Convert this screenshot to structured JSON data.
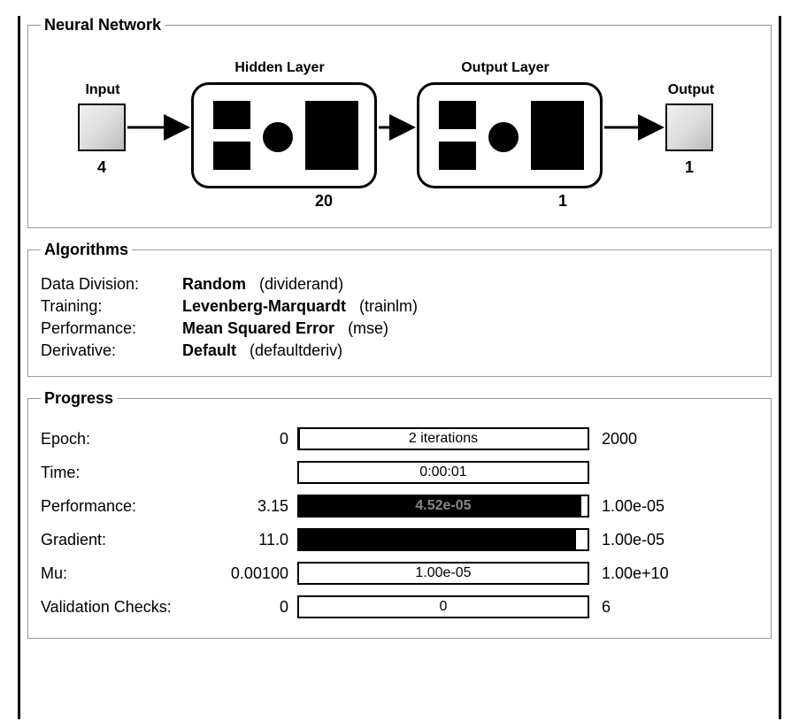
{
  "sections": {
    "nn": "Neural Network",
    "algo": "Algorithms",
    "prog": "Progress"
  },
  "network": {
    "input": {
      "label": "Input",
      "count": "4"
    },
    "hidden": {
      "label": "Hidden Layer",
      "count": "20"
    },
    "output_layer": {
      "label": "Output Layer",
      "count": "1"
    },
    "output": {
      "label": "Output",
      "count": "1"
    }
  },
  "algorithms": {
    "data_division": {
      "key": "Data Division:",
      "name": "Random",
      "fn": "(dividerand)"
    },
    "training": {
      "key": "Training:",
      "name": "Levenberg-Marquardt",
      "fn": "(trainlm)"
    },
    "performance": {
      "key": "Performance:",
      "name": "Mean Squared Error",
      "fn": "(mse)"
    },
    "derivative": {
      "key": "Derivative:",
      "name": "Default",
      "fn": "(defaultderiv)"
    }
  },
  "progress": {
    "epoch": {
      "label": "Epoch:",
      "min": "0",
      "text": "2 iterations",
      "max": "2000",
      "fill_pct": 0.1
    },
    "time": {
      "label": "Time:",
      "min": "",
      "text": "0:00:01",
      "max": "",
      "fill_pct": 0
    },
    "perf": {
      "label": "Performance:",
      "min": "3.15",
      "text": "4.52e-05",
      "max": "1.00e-05",
      "fill_pct": 98
    },
    "gradient": {
      "label": "Gradient:",
      "min": "11.0",
      "text": "",
      "max": "1.00e-05",
      "fill_pct": 96
    },
    "mu": {
      "label": "Mu:",
      "min": "0.00100",
      "text": "1.00e-05",
      "max": "1.00e+10",
      "fill_pct": 0
    },
    "validation": {
      "label": "Validation Checks:",
      "min": "0",
      "text": "0",
      "max": "6",
      "fill_pct": 0
    }
  }
}
